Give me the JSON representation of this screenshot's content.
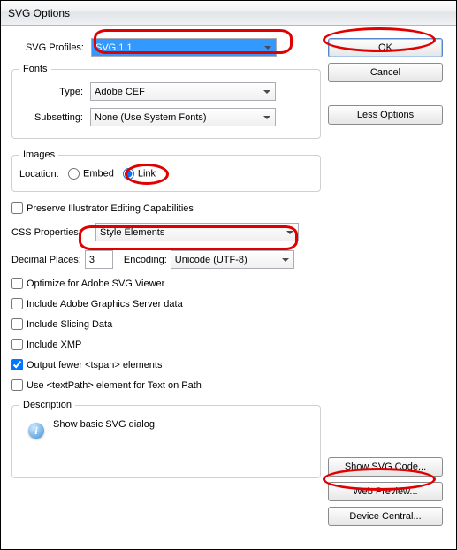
{
  "window": {
    "title": "SVG Options"
  },
  "svgProfiles": {
    "label": "SVG Profiles:",
    "value": "SVG 1.1"
  },
  "fonts": {
    "legend": "Fonts",
    "type": {
      "label": "Type:",
      "value": "Adobe CEF"
    },
    "subsetting": {
      "label": "Subsetting:",
      "value": "None (Use System Fonts)"
    }
  },
  "images": {
    "legend": "Images",
    "location": {
      "label": "Location:",
      "embed": "Embed",
      "link": "Link",
      "value": "link"
    }
  },
  "preserve": {
    "label": "Preserve Illustrator Editing Capabilities"
  },
  "css": {
    "label": "CSS Properties:",
    "value": "Style Elements"
  },
  "decimal": {
    "label": "Decimal Places:",
    "value": "3"
  },
  "encoding": {
    "label": "Encoding:",
    "value": "Unicode (UTF-8)"
  },
  "checks": {
    "optimize": "Optimize for Adobe SVG Viewer",
    "graphicsServer": "Include Adobe Graphics Server data",
    "slicing": "Include Slicing Data",
    "xmp": "Include XMP",
    "fewerTspan": "Output fewer <tspan> elements",
    "textpath": "Use <textPath> element for Text on Path"
  },
  "description": {
    "legend": "Description",
    "text": "Show basic SVG dialog."
  },
  "buttons": {
    "ok": "OK",
    "cancel": "Cancel",
    "lessOptions": "Less Options",
    "showSvg": "Show SVG Code...",
    "webPreview": "Web Preview...",
    "deviceCentral": "Device Central..."
  }
}
